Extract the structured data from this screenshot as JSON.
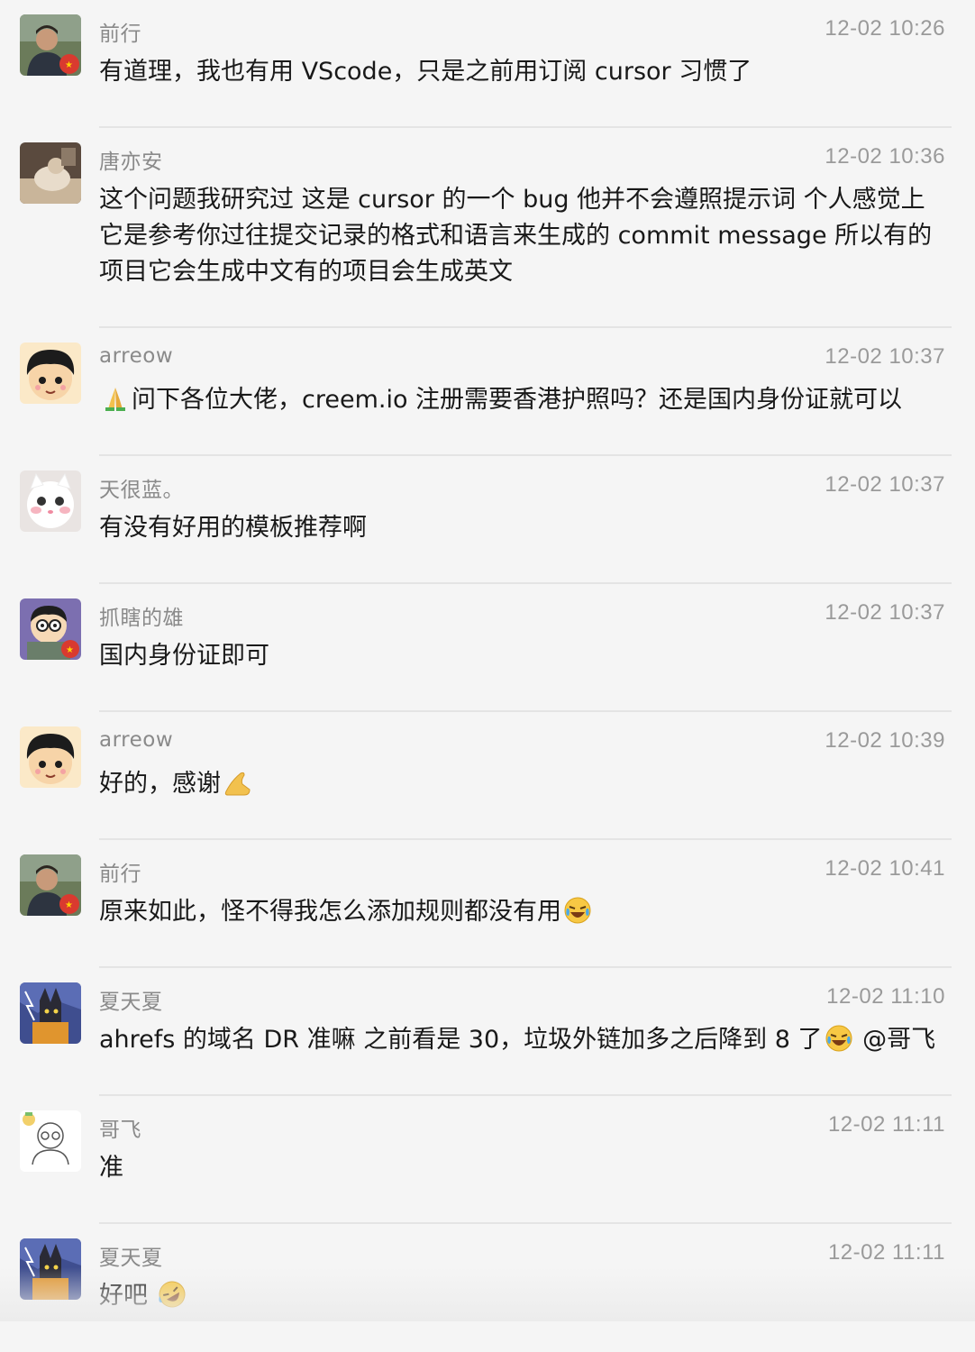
{
  "messages": [
    {
      "name": "前行",
      "time": "12-02 10:26",
      "text_before": "有道理，我也有用 VScode，只是之前用订阅 cursor 习惯了",
      "emoji": "",
      "text_after": "",
      "avatar": "man-photo-avatar"
    },
    {
      "name": "唐亦安",
      "time": "12-02 10:36",
      "text_before": "这个问题我研究过 这是 cursor 的一个 bug 他并不会遵照提示词 个人感觉上它是参考你过往提交记录的格式和语言来生成的 commit message 所以有的项目它会生成中文有的项目会生成英文",
      "emoji": "",
      "text_after": "",
      "avatar": "pet-photo-avatar"
    },
    {
      "name": "arreow",
      "time": "12-02 10:37",
      "text_before": "",
      "emoji": "folded-hands-emoji",
      "text_after": "问下各位大佬，creem.io 注册需要香港护照吗？还是国内身份证就可以",
      "avatar": "cartoon-boy-avatar"
    },
    {
      "name": "天很蓝。",
      "time": "12-02 10:37",
      "text_before": "有没有好用的模板推荐啊",
      "emoji": "",
      "text_after": "",
      "avatar": "white-cat-avatar"
    },
    {
      "name": "抓瞎的雄",
      "time": "12-02 10:37",
      "text_before": "国内身份证即可",
      "emoji": "",
      "text_after": "",
      "avatar": "nobita-avatar"
    },
    {
      "name": "arreow",
      "time": "12-02 10:39",
      "text_before": "好的，感谢",
      "emoji": "ok-hand-emoji",
      "text_after": "",
      "avatar": "cartoon-boy-avatar"
    },
    {
      "name": "前行",
      "time": "12-02 10:41",
      "text_before": "原来如此，怪不得我怎么添加规则都没有用",
      "emoji": "tears-of-joy-emoji",
      "text_after": "",
      "avatar": "man-photo-avatar"
    },
    {
      "name": "夏天夏",
      "time": "12-02 11:10",
      "text_before": "ahrefs 的域名 DR 准嘛 之前看是 30，垃圾外链加多之后降到 8 了",
      "emoji": "tears-of-joy-emoji",
      "text_after": " @哥飞",
      "avatar": "wolf-avatar"
    },
    {
      "name": "哥飞",
      "time": "12-02 11:11",
      "text_before": "准",
      "emoji": "",
      "text_after": "",
      "avatar": "sketch-man-avatar"
    },
    {
      "name": "夏天夏",
      "time": "12-02 11:11",
      "text_before": "好吧 ",
      "emoji": "rolling-laugh-emoji",
      "text_after": "",
      "avatar": "wolf-avatar"
    }
  ]
}
